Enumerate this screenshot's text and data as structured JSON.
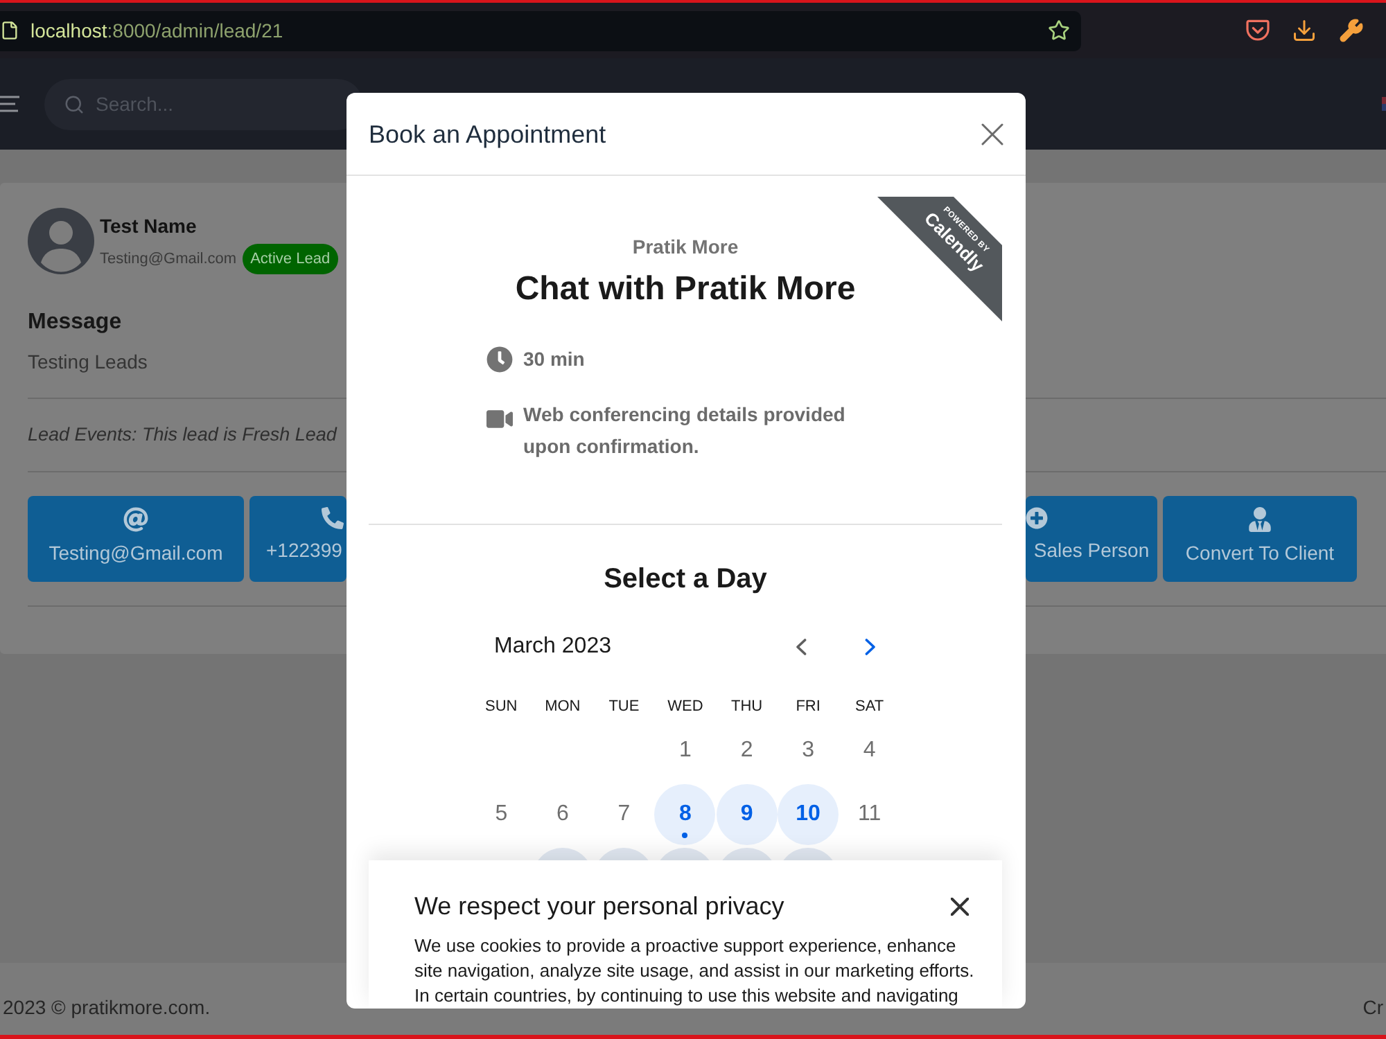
{
  "browser": {
    "url": {
      "host": "localhost",
      "path": ":8000/admin/lead/21"
    },
    "bookmarked": false
  },
  "header": {
    "search": {
      "placeholder": "Search..."
    }
  },
  "lead": {
    "name": "Test Name",
    "email": "Testing@Gmail.com",
    "status": "Active Lead",
    "message_label": "Message",
    "message": "Testing Leads",
    "events": "Lead Events: This lead is Fresh Lead",
    "actions": [
      {
        "kind": "email",
        "label": "Testing@Gmail.com"
      },
      {
        "kind": "phone",
        "label": "+122399"
      },
      {
        "kind": "add-person",
        "label": "Sales Person"
      },
      {
        "kind": "convert",
        "label": "Convert To Client"
      }
    ]
  },
  "footer": {
    "copyright": "2023 © pratikmore.com.",
    "right_text": "Cr"
  },
  "modal": {
    "title": "Book an Appointment",
    "scheduler": {
      "ribbon": {
        "caption": "POWERED BY",
        "brand": "Calendly"
      },
      "host": "Pratik More",
      "event": "Chat with Pratik More",
      "details": [
        {
          "kind": "duration",
          "text": "30 min"
        },
        {
          "kind": "video",
          "text": "Web conferencing details provided upon confirmation."
        }
      ],
      "heading": "Select a Day",
      "month": "March 2023",
      "prev": {
        "disabled": true
      },
      "next": {
        "disabled": false
      },
      "weekdays": [
        "SUN",
        "MON",
        "TUE",
        "WED",
        "THU",
        "FRI",
        "SAT"
      ],
      "weeks": [
        [
          {
            "kind": "blank"
          },
          {
            "kind": "blank"
          },
          {
            "kind": "blank"
          },
          {
            "kind": "day",
            "label": "1",
            "available": false,
            "today": false
          },
          {
            "kind": "day",
            "label": "2",
            "available": false,
            "today": false
          },
          {
            "kind": "day",
            "label": "3",
            "available": false,
            "today": false
          },
          {
            "kind": "day",
            "label": "4",
            "available": false,
            "today": false
          }
        ],
        [
          {
            "kind": "day",
            "label": "5",
            "available": false,
            "today": false
          },
          {
            "kind": "day",
            "label": "6",
            "available": false,
            "today": false
          },
          {
            "kind": "day",
            "label": "7",
            "available": false,
            "today": false
          },
          {
            "kind": "day",
            "label": "8",
            "available": true,
            "today": true
          },
          {
            "kind": "day",
            "label": "9",
            "available": true,
            "today": false
          },
          {
            "kind": "day",
            "label": "10",
            "available": true,
            "today": false
          },
          {
            "kind": "day",
            "label": "11",
            "available": false,
            "today": false
          }
        ],
        [
          {
            "kind": "blank"
          },
          {
            "kind": "covered",
            "available": true
          },
          {
            "kind": "covered",
            "available": true
          },
          {
            "kind": "covered",
            "available": true
          },
          {
            "kind": "covered",
            "available": true
          },
          {
            "kind": "covered",
            "available": true
          },
          {
            "kind": "blank"
          }
        ]
      ]
    },
    "cookie_banner": {
      "title": "We respect your personal privacy",
      "text": "We use cookies to provide a proactive support experience, enhance site navigation, analyze site usage, and assist in our marketing efforts. In certain countries, by continuing to use this website and navigating"
    }
  }
}
